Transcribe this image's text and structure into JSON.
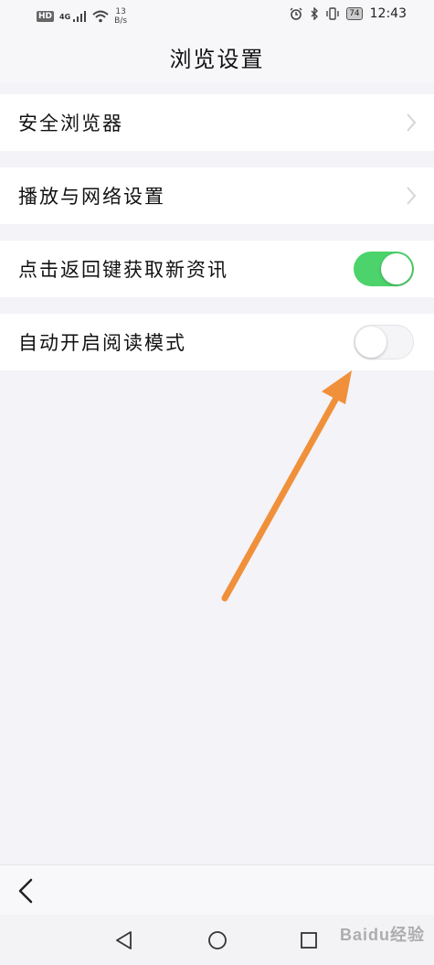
{
  "status_bar": {
    "hd": "HD",
    "network": "4G",
    "speed_value": "13",
    "speed_unit": "B/s",
    "battery": "74",
    "time": "12:43",
    "icons": [
      "signal-icon",
      "wifi-icon",
      "alarm-icon",
      "bluetooth-icon",
      "vibrate-icon",
      "battery-icon"
    ]
  },
  "header": {
    "title": "浏览设置"
  },
  "settings": [
    {
      "label": "安全浏览器",
      "control": "chevron"
    },
    {
      "label": "播放与网络设置",
      "control": "chevron"
    },
    {
      "label": "点击返回键获取新资讯",
      "control": "toggle",
      "enabled": true
    },
    {
      "label": "自动开启阅读模式",
      "control": "toggle",
      "enabled": false
    }
  ],
  "colors": {
    "toggle_on": "#4cd36b",
    "arrow": "#f0903a",
    "background": "#f3f3f8"
  },
  "watermark": "Baidu经验"
}
